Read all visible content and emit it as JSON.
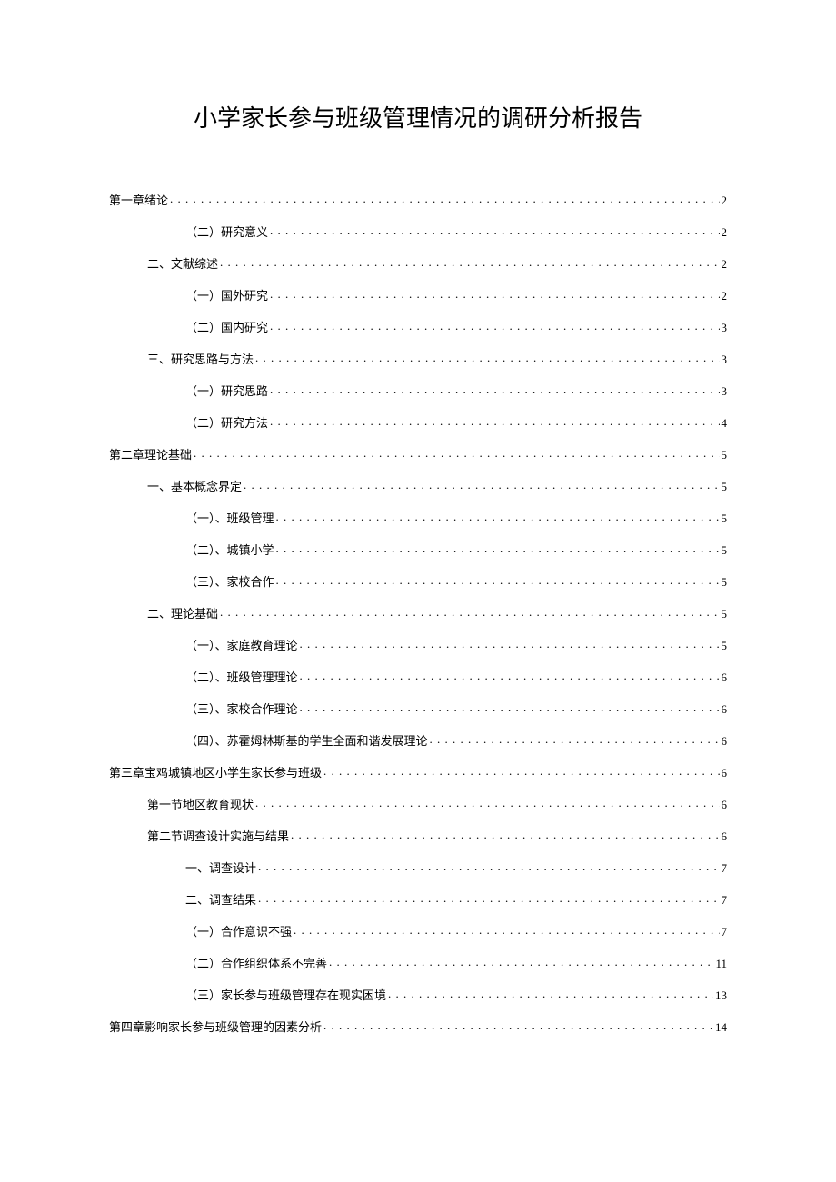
{
  "title": "小学家长参与班级管理情况的调研分析报告",
  "toc": [
    {
      "level": 0,
      "label": "第一章绪论",
      "page": "2"
    },
    {
      "level": 2,
      "label": "（二）研究意义",
      "page": "2"
    },
    {
      "level": 1,
      "label": "二、文献综述",
      "page": "2"
    },
    {
      "level": 2,
      "label": "（一）国外研究",
      "page": "2"
    },
    {
      "level": 2,
      "label": "（二）国内研究",
      "page": "3"
    },
    {
      "level": 1,
      "label": "三、研究思路与方法",
      "page": "3"
    },
    {
      "level": 2,
      "label": "（一）研究思路",
      "page": "3"
    },
    {
      "level": 2,
      "label": "（二）研究方法",
      "page": "4"
    },
    {
      "level": 0,
      "label": "第二章理论基础",
      "page": "5"
    },
    {
      "level": 1,
      "label": "一、基本概念界定",
      "page": "5"
    },
    {
      "level": 2,
      "label": "（一）、班级管理",
      "page": "5"
    },
    {
      "level": 2,
      "label": "（二）、城镇小学",
      "page": "5"
    },
    {
      "level": 2,
      "label": "（三）、家校合作",
      "page": "5"
    },
    {
      "level": 1,
      "label": "二、理论基础",
      "page": "5"
    },
    {
      "level": 2,
      "label": "（一）、家庭教育理论",
      "page": "5"
    },
    {
      "level": 2,
      "label": "（二）、班级管理理论",
      "page": "6"
    },
    {
      "level": 2,
      "label": "（三）、家校合作理论",
      "page": "6"
    },
    {
      "level": 2,
      "label": "（四）、苏霍姆林斯基的学生全面和谐发展理论",
      "page": "6"
    },
    {
      "level": 0,
      "label": "第三章宝鸡城镇地区小学生家长参与班级",
      "page": "6"
    },
    {
      "level": 1,
      "label": "第一节地区教育现状",
      "page": "6"
    },
    {
      "level": 1,
      "label": "第二节调查设计实施与结果",
      "page": "6"
    },
    {
      "level": 2,
      "label": "一、调查设计",
      "page": "7"
    },
    {
      "level": 2,
      "label": "二、调查结果",
      "page": "7"
    },
    {
      "level": 2,
      "label": "（一）合作意识不强",
      "page": "7"
    },
    {
      "level": 2,
      "label": "（二）合作组织体系不完善",
      "page": "11"
    },
    {
      "level": 2,
      "label": "（三）家长参与班级管理存在现实困境",
      "page": "13"
    },
    {
      "level": 0,
      "label": "第四章影响家长参与班级管理的因素分析",
      "page": "14"
    }
  ]
}
